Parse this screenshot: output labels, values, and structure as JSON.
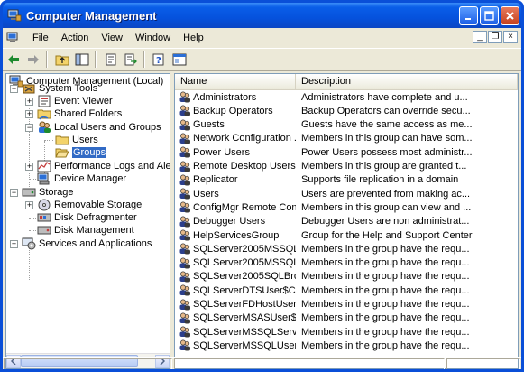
{
  "window": {
    "title": "Computer Management"
  },
  "menubar": {
    "items": [
      "File",
      "Action",
      "View",
      "Window",
      "Help"
    ]
  },
  "mdi_controls": [
    "_",
    "❐",
    "×"
  ],
  "toolbar": {
    "icons": [
      "back-arrow-icon",
      "forward-arrow-icon",
      "up-folder-icon",
      "show-hide-tree-icon",
      "properties-icon",
      "export-list-icon",
      "help-icon",
      "new-window-icon"
    ]
  },
  "tree": {
    "nodes": [
      {
        "label": "Computer Management (Local)",
        "level": 0,
        "icon": "computer-management-icon",
        "expander": ""
      },
      {
        "label": "System Tools",
        "level": 1,
        "icon": "system-tools-icon",
        "expander": "−"
      },
      {
        "label": "Event Viewer",
        "level": 2,
        "icon": "event-viewer-icon",
        "expander": "+"
      },
      {
        "label": "Shared Folders",
        "level": 2,
        "icon": "shared-folders-icon",
        "expander": "+"
      },
      {
        "label": "Local Users and Groups",
        "level": 2,
        "icon": "local-users-groups-icon",
        "expander": "−"
      },
      {
        "label": "Users",
        "level": 3,
        "icon": "folder-icon",
        "expander": ""
      },
      {
        "label": "Groups",
        "level": 3,
        "icon": "folder-open-icon",
        "expander": "",
        "selected": true
      },
      {
        "label": "Performance Logs and Alerts",
        "level": 2,
        "icon": "performance-logs-icon",
        "expander": "+"
      },
      {
        "label": "Device Manager",
        "level": 2,
        "icon": "device-manager-icon",
        "expander": ""
      },
      {
        "label": "Storage",
        "level": 1,
        "icon": "storage-icon",
        "expander": "−"
      },
      {
        "label": "Removable Storage",
        "level": 2,
        "icon": "removable-storage-icon",
        "expander": "+"
      },
      {
        "label": "Disk Defragmenter",
        "level": 2,
        "icon": "disk-defragmenter-icon",
        "expander": ""
      },
      {
        "label": "Disk Management",
        "level": 2,
        "icon": "disk-management-icon",
        "expander": ""
      },
      {
        "label": "Services and Applications",
        "level": 1,
        "icon": "services-applications-icon",
        "expander": "+"
      }
    ]
  },
  "list": {
    "columns": [
      "Name",
      "Description"
    ],
    "rows": [
      {
        "name": "Administrators",
        "description": "Administrators have complete and u..."
      },
      {
        "name": "Backup Operators",
        "description": "Backup Operators can override secu..."
      },
      {
        "name": "Guests",
        "description": "Guests have the same access as me..."
      },
      {
        "name": "Network Configuration ...",
        "description": "Members in this group can have som..."
      },
      {
        "name": "Power Users",
        "description": "Power Users possess most administr..."
      },
      {
        "name": "Remote Desktop Users",
        "description": "Members in this group are granted t..."
      },
      {
        "name": "Replicator",
        "description": "Supports file replication in a domain"
      },
      {
        "name": "Users",
        "description": "Users are prevented from making ac..."
      },
      {
        "name": "ConfigMgr Remote Con...",
        "description": "Members in this group can view and ..."
      },
      {
        "name": "Debugger Users",
        "description": "Debugger Users are non administrat..."
      },
      {
        "name": "HelpServicesGroup",
        "description": "Group for the Help and Support Center"
      },
      {
        "name": "SQLServer2005MSSQLS...",
        "description": "Members in the group have the requ..."
      },
      {
        "name": "SQLServer2005MSSQL...",
        "description": "Members in the group have the requ..."
      },
      {
        "name": "SQLServer2005SQLBro...",
        "description": "Members in the group have the requ..."
      },
      {
        "name": "SQLServerDTSUser$CO...",
        "description": "Members in the group have the requ..."
      },
      {
        "name": "SQLServerFDHostUser$...",
        "description": "Members in the group have the requ..."
      },
      {
        "name": "SQLServerMSASUser$C...",
        "description": "Members in the group have the requ..."
      },
      {
        "name": "SQLServerMSSQLServe...",
        "description": "Members in the group have the requ..."
      },
      {
        "name": "SQLServerMSSQLUser$...",
        "description": "Members in the group have the requ..."
      }
    ]
  },
  "colors": {
    "titlebar": "#0552dd",
    "selection": "#316ac5",
    "chrome": "#ece9d8"
  }
}
